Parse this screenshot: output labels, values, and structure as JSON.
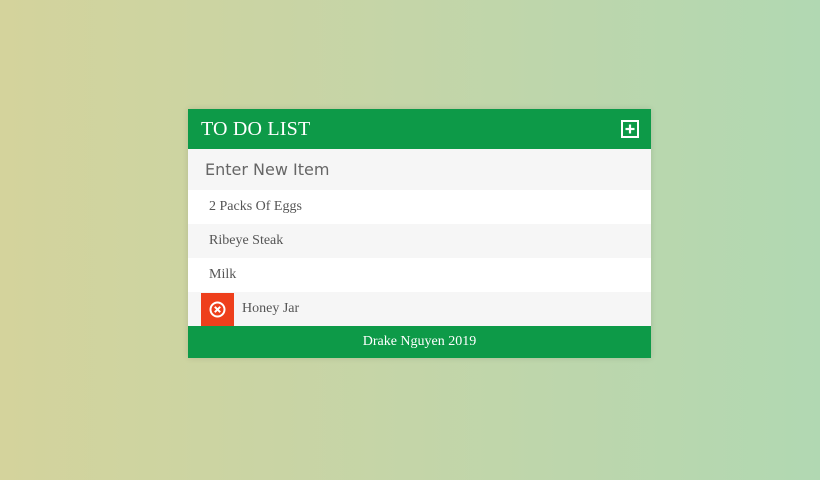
{
  "header": {
    "title": "TO DO LIST",
    "add_icon": "plus-square-icon"
  },
  "new_item": {
    "placeholder": "Enter New Item",
    "value": ""
  },
  "items": [
    {
      "label": "2 Packs Of Eggs",
      "hovered": false
    },
    {
      "label": "Ribeye Steak",
      "hovered": false
    },
    {
      "label": "Milk",
      "hovered": false
    },
    {
      "label": "Honey Jar",
      "hovered": true,
      "delete_icon": "close-circle-icon"
    }
  ],
  "footer": {
    "text": "Drake Nguyen 2019"
  },
  "colors": {
    "accent": "#0d9a48",
    "delete": "#ee3f1c",
    "row_alt": "#f6f6f6",
    "text": "#555555"
  }
}
